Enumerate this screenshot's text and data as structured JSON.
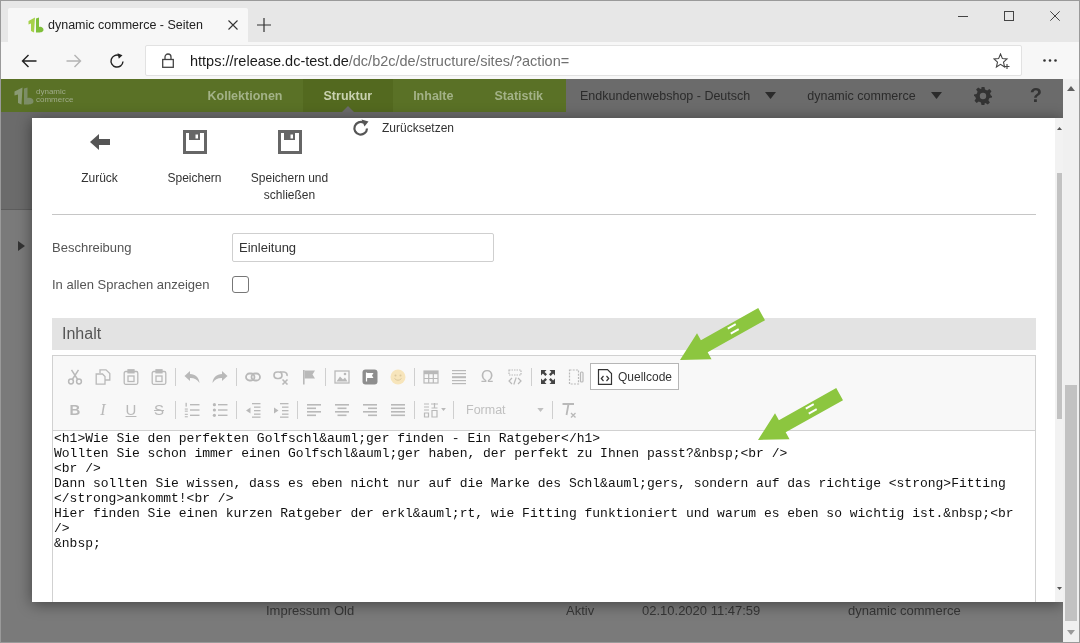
{
  "browser": {
    "tabs": [
      {
        "title": "dynamic commerce - Seiten",
        "selected": true
      }
    ],
    "forward_disabled": true,
    "url_host": "https://release.dc-test.de",
    "url_path": "/dc/b2c/de/structure/sites/?action="
  },
  "app_nav": {
    "logo_lines": [
      "dynamic",
      "commerce"
    ],
    "items": [
      {
        "label": "Kollektionen",
        "selected": false
      },
      {
        "label": "Struktur",
        "selected": true
      },
      {
        "label": "Inhalte",
        "selected": false
      },
      {
        "label": "Statistik",
        "selected": false
      }
    ],
    "shop_select": "Endkundenwebshop - Deutsch",
    "user_select": "dynamic commerce",
    "help": "?"
  },
  "background_page": {
    "tree_toggle": {
      "expanded": false
    },
    "row": {
      "name": "Impressum Old",
      "status": "Aktiv",
      "date": "02.10.2020 11:47:59",
      "author": "dynamic commerce"
    }
  },
  "dialog": {
    "toolbar": [
      {
        "kind": "back",
        "label": "Zurück"
      },
      {
        "kind": "save",
        "label": "Speichern"
      },
      {
        "kind": "save_close",
        "label": "Speichern und schließen"
      },
      {
        "kind": "reset",
        "label": "Zurücksetzen"
      }
    ],
    "fields": [
      {
        "kind": "text",
        "label": "Beschreibung",
        "value": "Einleitung"
      },
      {
        "kind": "checkbox",
        "label": "In allen Sprachen anzeigen",
        "checked": false
      }
    ],
    "section_title": "Inhalt",
    "editor": {
      "toolbar_rows": [
        [
          [
            {
              "kind": "icon",
              "disabled": true
            },
            {
              "kind": "icon",
              "disabled": true
            },
            {
              "kind": "icon",
              "disabled": true
            },
            {
              "kind": "icon",
              "disabled": true
            }
          ],
          [
            {
              "kind": "icon",
              "disabled": true
            },
            {
              "kind": "icon",
              "disabled": true
            }
          ],
          [
            {
              "kind": "icon",
              "disabled": true
            },
            {
              "kind": "icon",
              "disabled": true
            },
            {
              "kind": "icon",
              "disabled": true
            }
          ],
          [
            {
              "kind": "icon",
              "disabled": true
            },
            {
              "kind": "icon",
              "disabled": true
            },
            {
              "kind": "icon",
              "disabled": true
            }
          ],
          [
            {
              "kind": "icon",
              "disabled": true
            },
            {
              "kind": "icon",
              "disabled": true
            },
            {
              "kind": "glyph",
              "text": "Ω",
              "disabled": true
            },
            {
              "kind": "icon",
              "disabled": true
            }
          ],
          [
            {
              "kind": "icon",
              "disabled": false
            },
            {
              "kind": "icon",
              "disabled": true
            },
            {
              "kind": "text_button",
              "label": "Quellcode",
              "on": true,
              "disabled": false
            }
          ]
        ],
        [
          [
            {
              "kind": "glyph",
              "text": "B",
              "disabled": true
            },
            {
              "kind": "glyph",
              "text": "I",
              "disabled": true
            },
            {
              "kind": "glyph",
              "text": "U",
              "disabled": true
            },
            {
              "kind": "glyph",
              "text": "S",
              "disabled": true
            }
          ],
          [
            {
              "kind": "icon",
              "disabled": true
            },
            {
              "kind": "icon",
              "disabled": true
            }
          ],
          [
            {
              "kind": "icon",
              "disabled": true
            },
            {
              "kind": "icon",
              "disabled": true
            }
          ],
          [
            {
              "kind": "icon",
              "disabled": true
            },
            {
              "kind": "icon",
              "disabled": true
            },
            {
              "kind": "icon",
              "disabled": true
            },
            {
              "kind": "icon",
              "disabled": true
            }
          ],
          [
            {
              "kind": "icon_dropdown",
              "disabled": true
            }
          ],
          [
            {
              "kind": "dropdown",
              "label": "Format",
              "disabled": true
            }
          ],
          [
            {
              "kind": "icon",
              "disabled": true
            }
          ]
        ]
      ],
      "source_lines": [
        "<h1>Wie Sie den perfekten Golfschl&auml;ger finden - Ein Ratgeber</h1>",
        "Wollten Sie schon immer einen Golfschl&auml;ger haben, der perfekt zu Ihnen passt?&nbsp;<br />",
        "<br />",
        "Dann sollten Sie wissen, dass es eben nicht nur auf die Marke des Schl&auml;gers, sondern auf das richtige <strong>Fitting",
        "</strong>ankommt!<br />",
        "Hier finden Sie einen kurzen Ratgeber der erkl&auml;rt, wie Fitting funktioniert und warum es eben so wichtig ist.&nbsp;<br",
        "/>",
        "&nbsp;"
      ]
    }
  }
}
